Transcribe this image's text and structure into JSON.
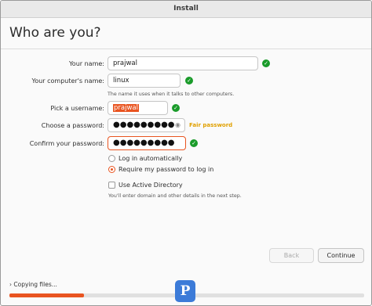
{
  "window": {
    "title": "Install"
  },
  "page": {
    "heading": "Who are you?"
  },
  "form": {
    "your_name": {
      "label": "Your name:",
      "value": "prajwal"
    },
    "computer_name": {
      "label": "Your computer's name:",
      "value": "linux",
      "hint": "The name it uses when it talks to other computers."
    },
    "username": {
      "label": "Pick a username:",
      "value": "prajwal"
    },
    "password": {
      "label": "Choose a password:",
      "value": "●●●●●●●●●",
      "strength": "Fair password"
    },
    "confirm": {
      "label": "Confirm your password:",
      "value": "●●●●●●●●●"
    }
  },
  "login": {
    "auto": "Log in automatically",
    "require": "Require my password to log in",
    "selected": "require"
  },
  "active_directory": {
    "label": "Use Active Directory",
    "hint": "You'll enter domain and other details in the next step."
  },
  "buttons": {
    "back": "Back",
    "continue": "Continue"
  },
  "progress": {
    "status": "Copying files...",
    "fraction": 0.21
  },
  "colors": {
    "accent": "#e95420",
    "ok": "#1a9b2a",
    "warn": "#e0a000"
  },
  "icons": {
    "valid": "check-circle-icon",
    "reveal": "eye-icon",
    "expand": "chevron-right-icon"
  }
}
